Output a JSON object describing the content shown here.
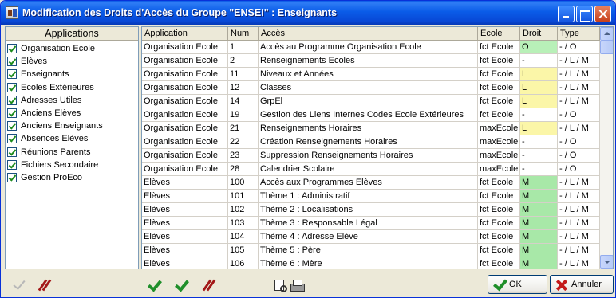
{
  "window": {
    "title": "Modification des Droits d'Accès du Groupe \"ENSEI\" : Enseignants",
    "accent": "#0a5ae6"
  },
  "left_panel": {
    "header": "Applications",
    "items": [
      {
        "label": "Organisation Ecole",
        "checked": true
      },
      {
        "label": "Elèves",
        "checked": true
      },
      {
        "label": "Enseignants",
        "checked": true
      },
      {
        "label": "Ecoles Extérieures",
        "checked": true
      },
      {
        "label": "Adresses Utiles",
        "checked": true
      },
      {
        "label": "Anciens Elèves",
        "checked": true
      },
      {
        "label": "Anciens Enseignants",
        "checked": true
      },
      {
        "label": "Absences Elèves",
        "checked": true
      },
      {
        "label": "Réunions Parents",
        "checked": true
      },
      {
        "label": "Fichiers Secondaire",
        "checked": true
      },
      {
        "label": "Gestion ProEco",
        "checked": true
      }
    ]
  },
  "table": {
    "columns": [
      "Application",
      "Num",
      "Accès",
      "Ecole",
      "Droit",
      "Type"
    ],
    "rows": [
      [
        "Organisation Ecole",
        "1",
        "Accès au Programme Organisation Ecole",
        "fct Ecole",
        "O",
        "- / O"
      ],
      [
        "Organisation Ecole",
        "2",
        "Renseignements Ecoles",
        "fct Ecole",
        "-",
        "- / L / M"
      ],
      [
        "Organisation Ecole",
        "11",
        "Niveaux et Années",
        "fct Ecole",
        "L",
        "- / L / M"
      ],
      [
        "Organisation Ecole",
        "12",
        "Classes",
        "fct Ecole",
        "L",
        "- / L / M"
      ],
      [
        "Organisation Ecole",
        "14",
        "GrpEl",
        "fct Ecole",
        "L",
        "- / L / M"
      ],
      [
        "Organisation Ecole",
        "19",
        "Gestion des Liens Internes Codes Ecole Extérieures",
        "fct Ecole",
        "-",
        "- / O"
      ],
      [
        "Organisation Ecole",
        "21",
        "Renseignements Horaires",
        "maxEcole",
        "L",
        "- / L / M"
      ],
      [
        "Organisation Ecole",
        "22",
        "Création Renseignements Horaires",
        "maxEcole",
        "-",
        "- / O"
      ],
      [
        "Organisation Ecole",
        "23",
        "Suppression Renseignements Horaires",
        "maxEcole",
        "-",
        "- / O"
      ],
      [
        "Organisation Ecole",
        "28",
        "Calendrier Scolaire",
        "maxEcole",
        "-",
        "- / O"
      ],
      [
        "Elèves",
        "100",
        "Accès aux Programmes Elèves",
        "fct Ecole",
        "M",
        "- / L / M"
      ],
      [
        "Elèves",
        "101",
        "Thème 1 : Administratif",
        "fct Ecole",
        "M",
        "- / L / M"
      ],
      [
        "Elèves",
        "102",
        "Thème 2 : Localisations",
        "fct Ecole",
        "M",
        "- / L / M"
      ],
      [
        "Elèves",
        "103",
        "Thème 3 : Responsable Légal",
        "fct Ecole",
        "M",
        "- / L / M"
      ],
      [
        "Elèves",
        "104",
        "Thème 4 : Adresse Elève",
        "fct Ecole",
        "M",
        "- / L / M"
      ],
      [
        "Elèves",
        "105",
        "Thème 5 : Père",
        "fct Ecole",
        "M",
        "- / L / M"
      ],
      [
        "Elèves",
        "106",
        "Thème 6 : Mère",
        "fct Ecole",
        "M",
        "- / L / M"
      ]
    ],
    "droit_colors": {
      "O": "#b8f0b8",
      "L": "#fbf6a8",
      "M": "#a8e8a8",
      "-": "#ffffff"
    }
  },
  "toolbar": {
    "ok_label": "OK",
    "cancel_label": "Annuler"
  }
}
